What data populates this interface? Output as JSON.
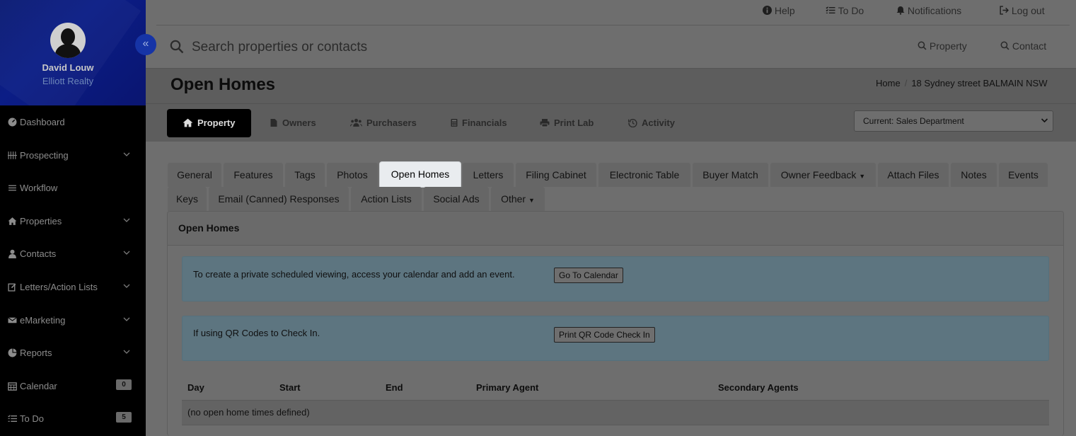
{
  "user": {
    "name": "David Louw",
    "company": "Elliott Realty"
  },
  "sidebar": {
    "items": [
      {
        "label": "Dashboard",
        "icon": "dashboard-icon"
      },
      {
        "label": "Prospecting",
        "icon": "prospecting-icon"
      },
      {
        "label": "Workflow",
        "icon": "workflow-icon"
      },
      {
        "label": "Properties",
        "icon": "home-icon"
      },
      {
        "label": "Contacts",
        "icon": "user-icon"
      },
      {
        "label": "Letters/Action Lists",
        "icon": "edit-icon"
      },
      {
        "label": "eMarketing",
        "icon": "envelope-icon"
      },
      {
        "label": "Reports",
        "icon": "pie-chart-icon"
      },
      {
        "label": "Calendar",
        "icon": "calendar-icon",
        "badge": "0"
      },
      {
        "label": "To Do",
        "icon": "list-icon",
        "badge": "5"
      }
    ]
  },
  "topbar": {
    "help": "Help",
    "todo": "To Do",
    "notifications": "Notifications",
    "logout": "Log out"
  },
  "search": {
    "placeholder": "Search properties or contacts",
    "property": "Property",
    "contact": "Contact"
  },
  "page": {
    "title": "Open Homes"
  },
  "breadcrumb": {
    "home": "Home",
    "sep": "/",
    "current": "18 Sydney street BALMAIN NSW"
  },
  "main_tabs": [
    {
      "label": "Property",
      "icon": "home-icon"
    },
    {
      "label": "Owners",
      "icon": "file-icon"
    },
    {
      "label": "Purchasers",
      "icon": "users-icon"
    },
    {
      "label": "Financials",
      "icon": "calculator-icon"
    },
    {
      "label": "Print Lab",
      "icon": "print-icon"
    },
    {
      "label": "Activity",
      "icon": "history-icon"
    }
  ],
  "department": {
    "selected": "Current: Sales Department"
  },
  "sub_tabs": [
    {
      "label": "General"
    },
    {
      "label": "Features"
    },
    {
      "label": "Tags"
    },
    {
      "label": "Photos"
    },
    {
      "label": "Open Homes"
    },
    {
      "label": "Letters"
    },
    {
      "label": "Filing Cabinet"
    },
    {
      "label": "Electronic Table"
    },
    {
      "label": "Buyer Match"
    },
    {
      "label": "Owner Feedback"
    },
    {
      "label": "Attach Files"
    },
    {
      "label": "Notes"
    },
    {
      "label": "Events"
    },
    {
      "label": "Keys"
    },
    {
      "label": "Email (Canned) Responses"
    },
    {
      "label": "Action Lists"
    },
    {
      "label": "Social Ads"
    },
    {
      "label": "Other"
    }
  ],
  "panel": {
    "title": "Open Homes",
    "info1": {
      "text": "To create a private scheduled viewing, access your calendar and add an event.",
      "button": "Go To Calendar"
    },
    "info2": {
      "text": "If using QR Codes to Check In.",
      "button": "Print QR Code Check In"
    },
    "table": {
      "headers": [
        "Day",
        "Start",
        "End",
        "Primary Agent",
        "Secondary Agents"
      ],
      "empty": "(no open home times defined)"
    }
  },
  "colors": {
    "sidebar_bg": "#000000",
    "profile_bg": "#0b1d86",
    "active_tab": "#000000",
    "info_box": "#5d7580"
  }
}
